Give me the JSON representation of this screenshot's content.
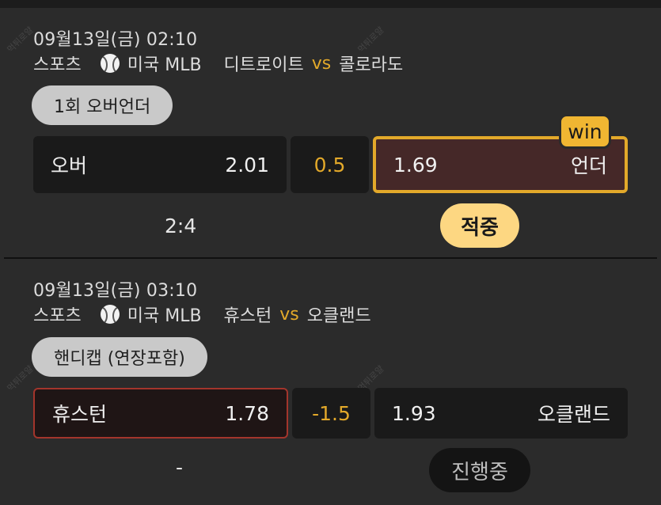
{
  "watermark": "먹튀로얄",
  "matches": [
    {
      "datetime": "09월13일(금) 02:10",
      "sport": "스포츠",
      "league": "미국 MLB",
      "home": "디트로이트",
      "vs": "vs",
      "away": "콜로라도",
      "market": "1회 오버언더",
      "left_label": "오버",
      "left_odds": "2.01",
      "line": "0.5",
      "right_odds": "1.69",
      "right_label": "언더",
      "badge": "win",
      "score": "2:4",
      "status": "적중"
    },
    {
      "datetime": "09월13일(금) 03:10",
      "sport": "스포츠",
      "league": "미국 MLB",
      "home": "휴스턴",
      "vs": "vs",
      "away": "오클랜드",
      "market": "핸디캡 (연장포함)",
      "left_label": "휴스턴",
      "left_odds": "1.78",
      "line": "-1.5",
      "right_odds": "1.93",
      "right_label": "오클랜드",
      "score": "-",
      "status": "진행중"
    }
  ],
  "colors": {
    "accent": "#e3a92a",
    "win_badge": "#f0b632",
    "status_hit": "#fdd782",
    "selected_red": "#a3352c"
  },
  "icons": [
    "baseball-icon"
  ]
}
